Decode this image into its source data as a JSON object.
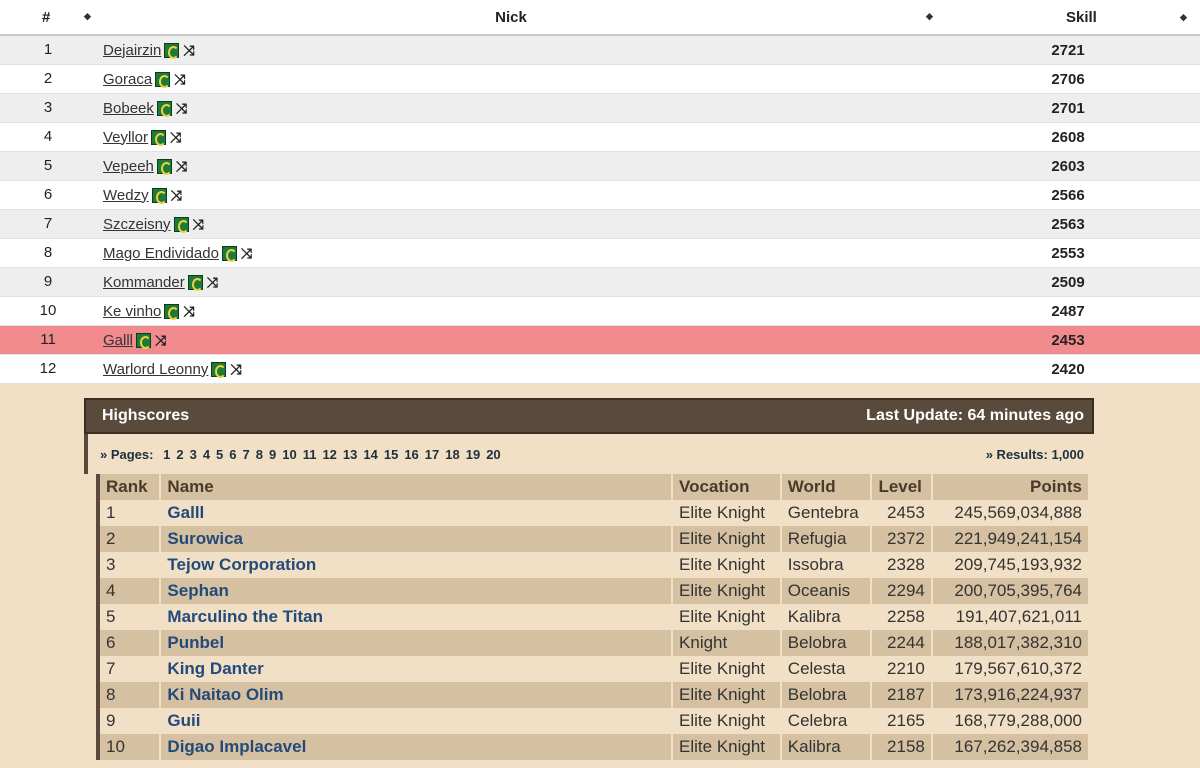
{
  "top_table": {
    "headers": {
      "rank": "#",
      "nick": "Nick",
      "skill": "Skill"
    },
    "rows": [
      {
        "rank": "1",
        "nick": "Dejairzin",
        "skill": "2721"
      },
      {
        "rank": "2",
        "nick": "Goraca",
        "skill": "2706"
      },
      {
        "rank": "3",
        "nick": "Bobeek",
        "skill": "2701"
      },
      {
        "rank": "4",
        "nick": "Veyllor",
        "skill": "2608"
      },
      {
        "rank": "5",
        "nick": "Vepeeh",
        "skill": "2603"
      },
      {
        "rank": "6",
        "nick": "Wedzy",
        "skill": "2566"
      },
      {
        "rank": "7",
        "nick": "Szczeisny",
        "skill": "2563"
      },
      {
        "rank": "8",
        "nick": "Mago Endividado",
        "skill": "2553"
      },
      {
        "rank": "9",
        "nick": "Kommander",
        "skill": "2509"
      },
      {
        "rank": "10",
        "nick": "Ke vinho",
        "skill": "2487"
      },
      {
        "rank": "11",
        "nick": "Galll",
        "skill": "2453",
        "highlighted": true
      },
      {
        "rank": "12",
        "nick": "Warlord Leonny",
        "skill": "2420"
      }
    ]
  },
  "highscores": {
    "title": "Highscores",
    "last_update": "Last Update: 64 minutes ago",
    "pages_label": "» Pages:",
    "pages": [
      "1",
      "2",
      "3",
      "4",
      "5",
      "6",
      "7",
      "8",
      "9",
      "10",
      "11",
      "12",
      "13",
      "14",
      "15",
      "16",
      "17",
      "18",
      "19",
      "20"
    ],
    "results": "» Results: 1,000",
    "columns": {
      "rank": "Rank",
      "name": "Name",
      "vocation": "Vocation",
      "world": "World",
      "level": "Level",
      "points": "Points"
    },
    "rows": [
      {
        "rank": "1",
        "name": "Galll",
        "vocation": "Elite Knight",
        "world": "Gentebra",
        "level": "2453",
        "points": "245,569,034,888"
      },
      {
        "rank": "2",
        "name": "Surowica",
        "vocation": "Elite Knight",
        "world": "Refugia",
        "level": "2372",
        "points": "221,949,241,154"
      },
      {
        "rank": "3",
        "name": "Tejow Corporation",
        "vocation": "Elite Knight",
        "world": "Issobra",
        "level": "2328",
        "points": "209,745,193,932"
      },
      {
        "rank": "4",
        "name": "Sephan",
        "vocation": "Elite Knight",
        "world": "Oceanis",
        "level": "2294",
        "points": "200,705,395,764"
      },
      {
        "rank": "5",
        "name": "Marculino the Titan",
        "vocation": "Elite Knight",
        "world": "Kalibra",
        "level": "2258",
        "points": "191,407,621,011"
      },
      {
        "rank": "6",
        "name": "Punbel",
        "vocation": "Knight",
        "world": "Belobra",
        "level": "2244",
        "points": "188,017,382,310"
      },
      {
        "rank": "7",
        "name": "King Danter",
        "vocation": "Elite Knight",
        "world": "Celesta",
        "level": "2210",
        "points": "179,567,610,372"
      },
      {
        "rank": "8",
        "name": "Ki Naitao Olim",
        "vocation": "Elite Knight",
        "world": "Belobra",
        "level": "2187",
        "points": "173,916,224,937"
      },
      {
        "rank": "9",
        "name": "Guii",
        "vocation": "Elite Knight",
        "world": "Celebra",
        "level": "2165",
        "points": "168,779,288,000"
      },
      {
        "rank": "10",
        "name": "Digao Implacavel",
        "vocation": "Elite Knight",
        "world": "Kalibra",
        "level": "2158",
        "points": "167,262,394,858"
      }
    ]
  },
  "colors": {
    "highlight_row": "#f28b8e",
    "panel_header": "#5a4a3b",
    "name_link": "#234a7a"
  }
}
